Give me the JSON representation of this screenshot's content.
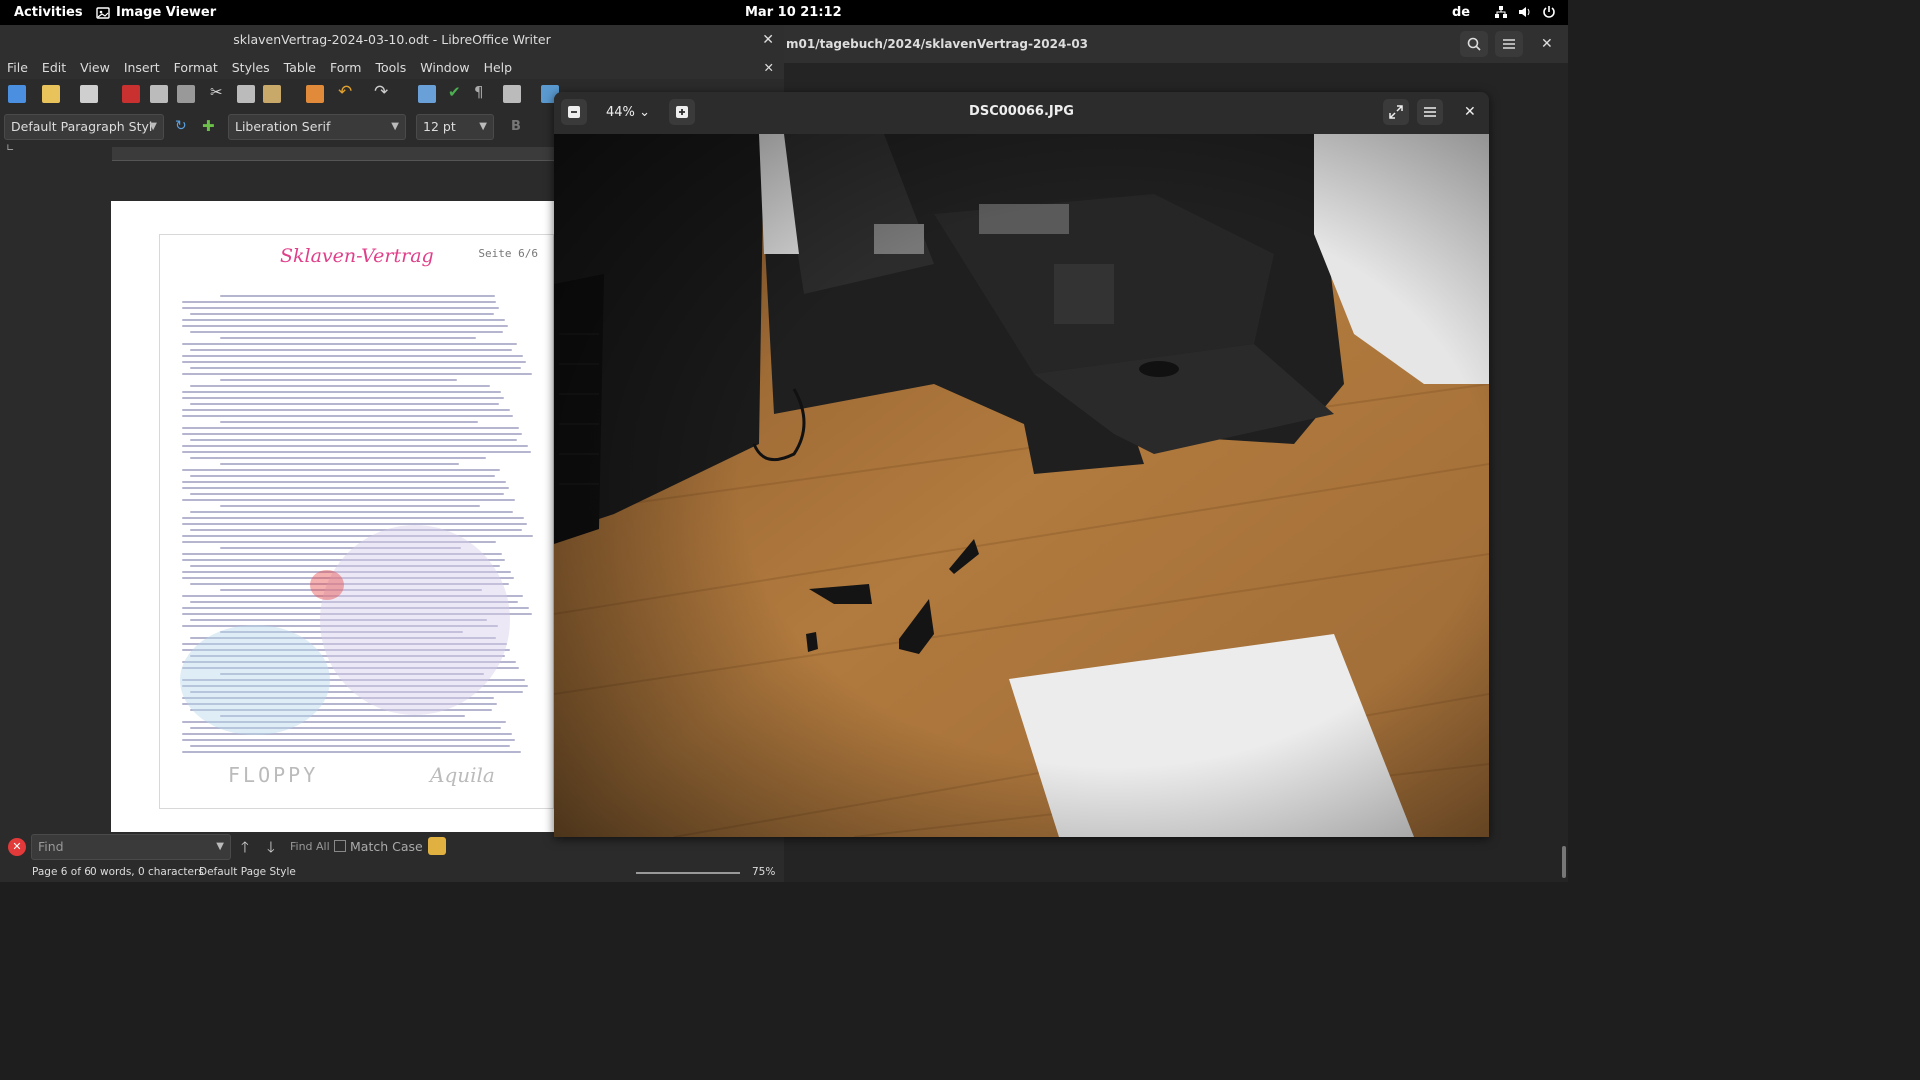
{
  "topbar": {
    "activities": "Activities",
    "app_name": "Image Viewer",
    "clock": "Mar 10  21:12",
    "lang": "de"
  },
  "bg_window": {
    "path": "m01/tagebuch/2024/sklavenVertrag-2024-03"
  },
  "writer": {
    "title": "sklavenVertrag-2024-03-10.odt - LibreOffice Writer",
    "menu": [
      "File",
      "Edit",
      "View",
      "Insert",
      "Format",
      "Styles",
      "Table",
      "Form",
      "Tools",
      "Window",
      "Help"
    ],
    "paragraph_style": "Default Paragraph Styl",
    "font_name": "Liberation Serif",
    "font_size": "12 pt",
    "bold_label": "B",
    "document": {
      "title": "Sklaven-Vertrag",
      "page_label": "Seite 6/6",
      "signature_left": "FLOPPY",
      "signature_right": "Aquila"
    },
    "find": {
      "placeholder": "Find",
      "find_all": "Find All",
      "match_case": "Match Case"
    },
    "status": {
      "page": "Page 6 of 6",
      "words": "0 words, 0 characters",
      "page_style": "Default Page Style",
      "zoom": "75%"
    }
  },
  "viewer": {
    "filename": "DSC00066.JPG",
    "zoom": "44%"
  },
  "colors": {
    "accent_title": "#e0408a",
    "close_red": "#e23a3a"
  }
}
